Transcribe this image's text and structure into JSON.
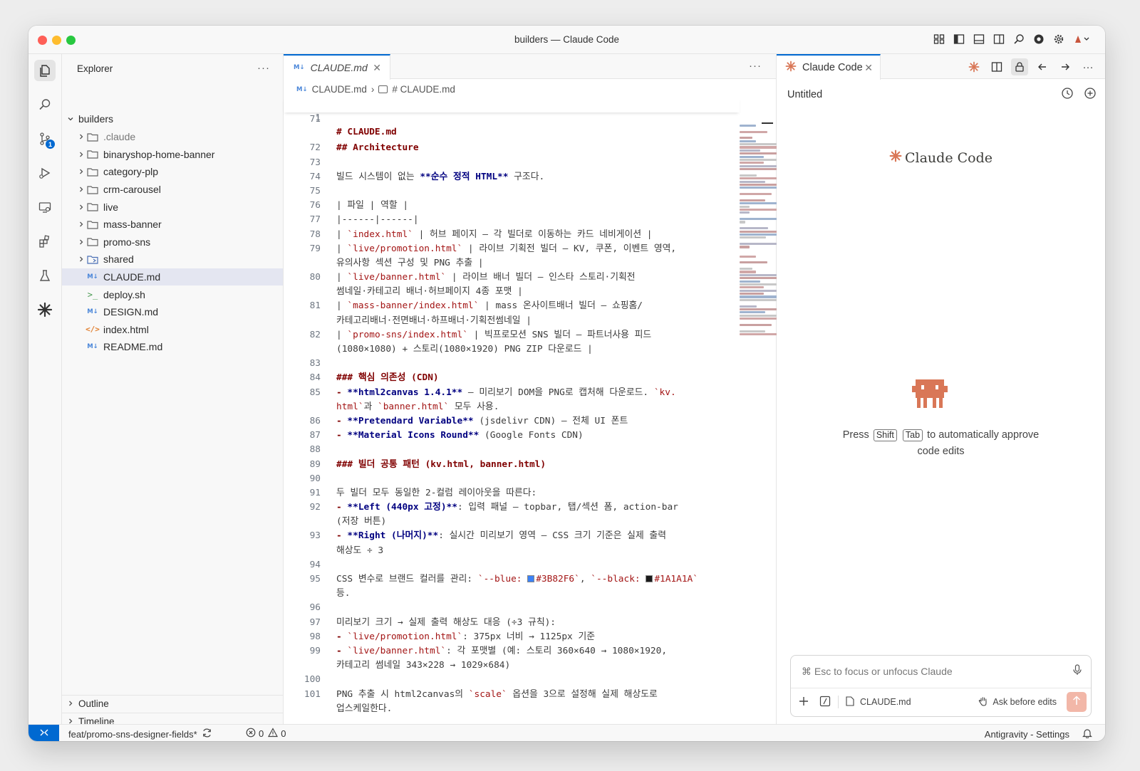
{
  "window": {
    "title": "builders — Claude Code"
  },
  "activity_bar": {
    "scm_badge": "1"
  },
  "sidebar": {
    "header": "Explorer",
    "more": "···",
    "root": "builders",
    "items": [
      {
        "label": ".claude",
        "type": "folder",
        "dim": true
      },
      {
        "label": "binaryshop-home-banner",
        "type": "folder"
      },
      {
        "label": "category-plp",
        "type": "folder"
      },
      {
        "label": "crm-carousel",
        "type": "folder"
      },
      {
        "label": "live",
        "type": "folder"
      },
      {
        "label": "mass-banner",
        "type": "folder"
      },
      {
        "label": "promo-sns",
        "type": "folder"
      },
      {
        "label": "shared",
        "type": "folder-special"
      },
      {
        "label": "CLAUDE.md",
        "type": "md",
        "selected": true
      },
      {
        "label": "deploy.sh",
        "type": "sh"
      },
      {
        "label": "DESIGN.md",
        "type": "md"
      },
      {
        "label": "index.html",
        "type": "html"
      },
      {
        "label": "README.md",
        "type": "md"
      }
    ],
    "outline": "Outline",
    "timeline": "Timeline"
  },
  "editor": {
    "tab_label": "CLAUDE.md",
    "tab_icon": "M↓",
    "more": "···",
    "breadcrumb": {
      "file": "CLAUDE.md",
      "symbol": "# CLAUDE.md"
    },
    "sticky": {
      "num": "1",
      "text": "# CLAUDE.md"
    },
    "lines": [
      {
        "num": "71",
        "parts": []
      },
      {
        "num": "",
        "parts": []
      },
      {
        "num": "72",
        "parts": [
          {
            "t": "## Architecture",
            "c": "h"
          }
        ]
      },
      {
        "num": "73",
        "parts": []
      },
      {
        "num": "74",
        "parts": [
          {
            "t": "빌드 시스템이 없는 "
          },
          {
            "t": "**순수 정적 HTML**",
            "c": "b"
          },
          {
            "t": " 구조다."
          }
        ]
      },
      {
        "num": "75",
        "parts": []
      },
      {
        "num": "76",
        "parts": [
          {
            "t": "| 파일 | 역할 |"
          }
        ]
      },
      {
        "num": "77",
        "parts": [
          {
            "t": "|------|------|"
          }
        ]
      },
      {
        "num": "78",
        "parts": [
          {
            "t": "| "
          },
          {
            "t": "`index.html`",
            "c": "c"
          },
          {
            "t": " | 허브 페이지 — 각 빌더로 이동하는 카드 네비게이션 |"
          }
        ]
      },
      {
        "num": "79",
        "parts": [
          {
            "t": "| "
          },
          {
            "t": "`live/promotion.html`",
            "c": "c"
          },
          {
            "t": " | 라이브 기획전 빌더 — KV, 쿠폰, 이벤트 영역,"
          }
        ]
      },
      {
        "num": "",
        "parts": [
          {
            "t": "유의사항 섹션 구성 및 PNG 추출 |"
          }
        ]
      },
      {
        "num": "80",
        "parts": [
          {
            "t": "| "
          },
          {
            "t": "`live/banner.html`",
            "c": "c"
          },
          {
            "t": " | 라이브 배너 빌더 — 인스타 스토리·기획전"
          }
        ]
      },
      {
        "num": "",
        "parts": [
          {
            "t": "썸네일·카테고리 배너·허브페이지 4종 포맷 |"
          }
        ]
      },
      {
        "num": "81",
        "parts": [
          {
            "t": "| "
          },
          {
            "t": "`mass-banner/index.html`",
            "c": "c"
          },
          {
            "t": " | mass 온사이트배너 빌더 — 쇼핑홈/"
          }
        ]
      },
      {
        "num": "",
        "parts": [
          {
            "t": "카테고리배너·전면배너·하프배너·기획전썸네일 |"
          }
        ]
      },
      {
        "num": "82",
        "parts": [
          {
            "t": "| "
          },
          {
            "t": "`promo-sns/index.html`",
            "c": "c"
          },
          {
            "t": " | 빅프로모션 SNS 빌더 — 파트너사용 피드"
          }
        ]
      },
      {
        "num": "",
        "parts": [
          {
            "t": "(1080×1080) + 스토리(1080×1920) PNG ZIP 다운로드 |"
          }
        ]
      },
      {
        "num": "83",
        "parts": []
      },
      {
        "num": "84",
        "parts": [
          {
            "t": "### 핵심 의존성 (CDN)",
            "c": "h"
          }
        ]
      },
      {
        "num": "85",
        "parts": [
          {
            "t": "- ",
            "c": "h"
          },
          {
            "t": "**html2canvas 1.4.1**",
            "c": "b"
          },
          {
            "t": " — 미리보기 DOM을 PNG로 캡처해 다운로드. "
          },
          {
            "t": "`kv.",
            "c": "c"
          }
        ]
      },
      {
        "num": "",
        "parts": [
          {
            "t": "html`",
            "c": "c"
          },
          {
            "t": "과 "
          },
          {
            "t": "`banner.html`",
            "c": "c"
          },
          {
            "t": " 모두 사용."
          }
        ]
      },
      {
        "num": "86",
        "parts": [
          {
            "t": "- ",
            "c": "h"
          },
          {
            "t": "**Pretendard Variable**",
            "c": "b"
          },
          {
            "t": " (jsdelivr CDN) — 전체 UI 폰트"
          }
        ]
      },
      {
        "num": "87",
        "parts": [
          {
            "t": "- ",
            "c": "h"
          },
          {
            "t": "**Material Icons Round**",
            "c": "b"
          },
          {
            "t": " (Google Fonts CDN)"
          }
        ]
      },
      {
        "num": "88",
        "parts": []
      },
      {
        "num": "89",
        "parts": [
          {
            "t": "### 빌더 공통 패턴 (kv.html, banner.html)",
            "c": "h"
          }
        ]
      },
      {
        "num": "90",
        "parts": []
      },
      {
        "num": "91",
        "parts": [
          {
            "t": "두 빌더 모두 동일한 2-컬럼 레이아웃을 따른다:"
          }
        ]
      },
      {
        "num": "92",
        "parts": [
          {
            "t": "- ",
            "c": "h"
          },
          {
            "t": "**Left (440px 고정)**",
            "c": "b"
          },
          {
            "t": ": 입력 패널 — topbar, 탭/섹션 폼, action-bar"
          }
        ]
      },
      {
        "num": "",
        "parts": [
          {
            "t": "(저장 버튼)"
          }
        ]
      },
      {
        "num": "93",
        "parts": [
          {
            "t": "- ",
            "c": "h"
          },
          {
            "t": "**Right (나머지)**",
            "c": "b"
          },
          {
            "t": ": 실시간 미리보기 영역 — CSS 크기 기준은 실제 출력"
          }
        ]
      },
      {
        "num": "",
        "parts": [
          {
            "t": "해상도 ÷ 3"
          }
        ]
      },
      {
        "num": "94",
        "parts": []
      },
      {
        "num": "95",
        "parts": [
          {
            "t": "CSS 변수로 브랜드 컬러를 관리: "
          },
          {
            "t": "`--blue: ",
            "c": "c"
          },
          {
            "sw": "#3B82F6"
          },
          {
            "t": "#3B82F6`",
            "c": "c"
          },
          {
            "t": ", "
          },
          {
            "t": "`--black: ",
            "c": "c"
          },
          {
            "sw": "#1A1A1A"
          },
          {
            "t": "#1A1A1A`",
            "c": "c"
          }
        ]
      },
      {
        "num": "",
        "parts": [
          {
            "t": "등."
          }
        ]
      },
      {
        "num": "96",
        "parts": []
      },
      {
        "num": "97",
        "parts": [
          {
            "t": "미리보기 크기 → 실제 출력 해상도 대응 (÷3 규칙):"
          }
        ]
      },
      {
        "num": "98",
        "parts": [
          {
            "t": "- ",
            "c": "h"
          },
          {
            "t": "`live/promotion.html`",
            "c": "c"
          },
          {
            "t": ": 375px 너비 → 1125px 기준"
          }
        ]
      },
      {
        "num": "99",
        "parts": [
          {
            "t": "- ",
            "c": "h"
          },
          {
            "t": "`live/banner.html`",
            "c": "c"
          },
          {
            "t": ": 각 포맷별 (예: 스토리 360×640 → 1080×1920,"
          }
        ]
      },
      {
        "num": "",
        "parts": [
          {
            "t": "카테고리 썸네일 343×228 → 1029×684)"
          }
        ]
      },
      {
        "num": "100",
        "parts": []
      },
      {
        "num": "101",
        "parts": [
          {
            "t": "PNG 추출 시 html2canvas의 "
          },
          {
            "t": "`scale`",
            "c": "c"
          },
          {
            "t": " 옵션을 3으로 설정해 실제 해상도로"
          }
        ]
      },
      {
        "num": "",
        "parts": [
          {
            "t": "업스케일한다."
          }
        ]
      }
    ]
  },
  "claude": {
    "tab_label": "Claude Code",
    "title": "Untitled",
    "brand": "Claude Code",
    "hint_press": "Press",
    "key_shift": "Shift",
    "key_tab": "Tab",
    "hint_rest": "to automatically approve",
    "hint_line2": "code edits",
    "input_placeholder": "⌘ Esc to focus or unfocus Claude",
    "context_file": "CLAUDE.md",
    "mode": "Ask before edits",
    "accent": "#d97757"
  },
  "statusbar": {
    "branch": "feat/promo-sns-designer-fields*",
    "errors": "0",
    "warnings": "0",
    "right_label": "Antigravity - Settings"
  }
}
